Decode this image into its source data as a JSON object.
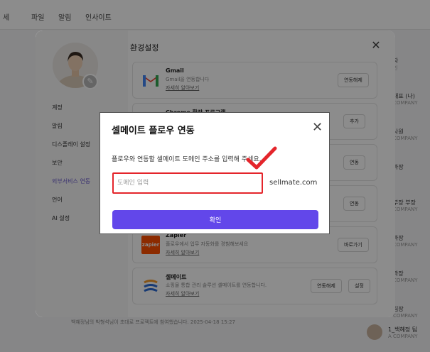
{
  "background": {
    "topbar_items": [
      "세",
      "파일",
      "알림",
      "인사이트"
    ],
    "right_column": [
      {
        "name": "자",
        "sub": "인"
      },
      {
        "name": "대표 (나)",
        "sub": "COMPANY"
      },
      {
        "name": "사원",
        "sub": "COMPANY"
      },
      {
        "name": "과장",
        "sub": ""
      },
      {
        "name": "부장 부장",
        "sub": "COMPANY"
      },
      {
        "name": "과장",
        "sub": "COMPANY"
      },
      {
        "name": "과장",
        "sub": "COMPANY"
      },
      {
        "name": "팀장",
        "sub": "COMPANY"
      },
      {
        "name": "책수 자장",
        "sub": "COMPANY"
      },
      {
        "name": "팀 주임",
        "sub": "COMPANY"
      }
    ],
    "bottom_text": "백혜정님의 박형석님이 초대로 프로젝트에 참여했습니다. 2025-04-18 15:27",
    "user": {
      "name": "1_백혜정 팀",
      "company": "A COMPANY"
    }
  },
  "settings": {
    "title": "환경설정",
    "menu": [
      {
        "label": "계정",
        "active": false
      },
      {
        "label": "알림",
        "active": false
      },
      {
        "label": "디스플레이 설정",
        "active": false
      },
      {
        "label": "보안",
        "active": false
      },
      {
        "label": "외부서비스 연동",
        "active": true
      },
      {
        "label": "언어",
        "active": false
      },
      {
        "label": "AI 설정",
        "active": false
      }
    ],
    "integrations": [
      {
        "name": "Gmail",
        "desc": "Gmail을 연동합니다",
        "link": "자세히 알아보기",
        "buttons": [
          "연동해제"
        ]
      },
      {
        "name": "Chrome 확장 프로그램",
        "desc": "",
        "link": "",
        "buttons": [
          "추가"
        ]
      },
      {
        "name": "",
        "desc": "",
        "link": "",
        "buttons": [
          "연동"
        ]
      },
      {
        "name": "",
        "desc": "",
        "link": "",
        "buttons": [
          "연동"
        ]
      },
      {
        "name": "Zapier",
        "desc": "플로우에서 업무 자동화를 경험해보세요",
        "link": "자세히 알아보기",
        "buttons": [
          "바로가기"
        ],
        "logo_text": "zapier"
      },
      {
        "name": "셀메이트",
        "desc": "쇼핑몰 통합 관리 솔루션 셀메이트를 연동합니다.",
        "link": "자세히 알아보기",
        "buttons": [
          "연동해제",
          "설정"
        ]
      }
    ]
  },
  "dialog": {
    "title": "셀메이트 플로우 연동",
    "description": "플로우와 연동할 셀메이트 도메인 주소를 입력해 주세요.",
    "input_placeholder": "도메인 입력",
    "input_value": "",
    "domain_suffix": "sellmate.com",
    "confirm_label": "확인"
  },
  "colors": {
    "primary": "#6247ea",
    "highlight": "#e4252b",
    "active_menu": "#6a5acd"
  }
}
